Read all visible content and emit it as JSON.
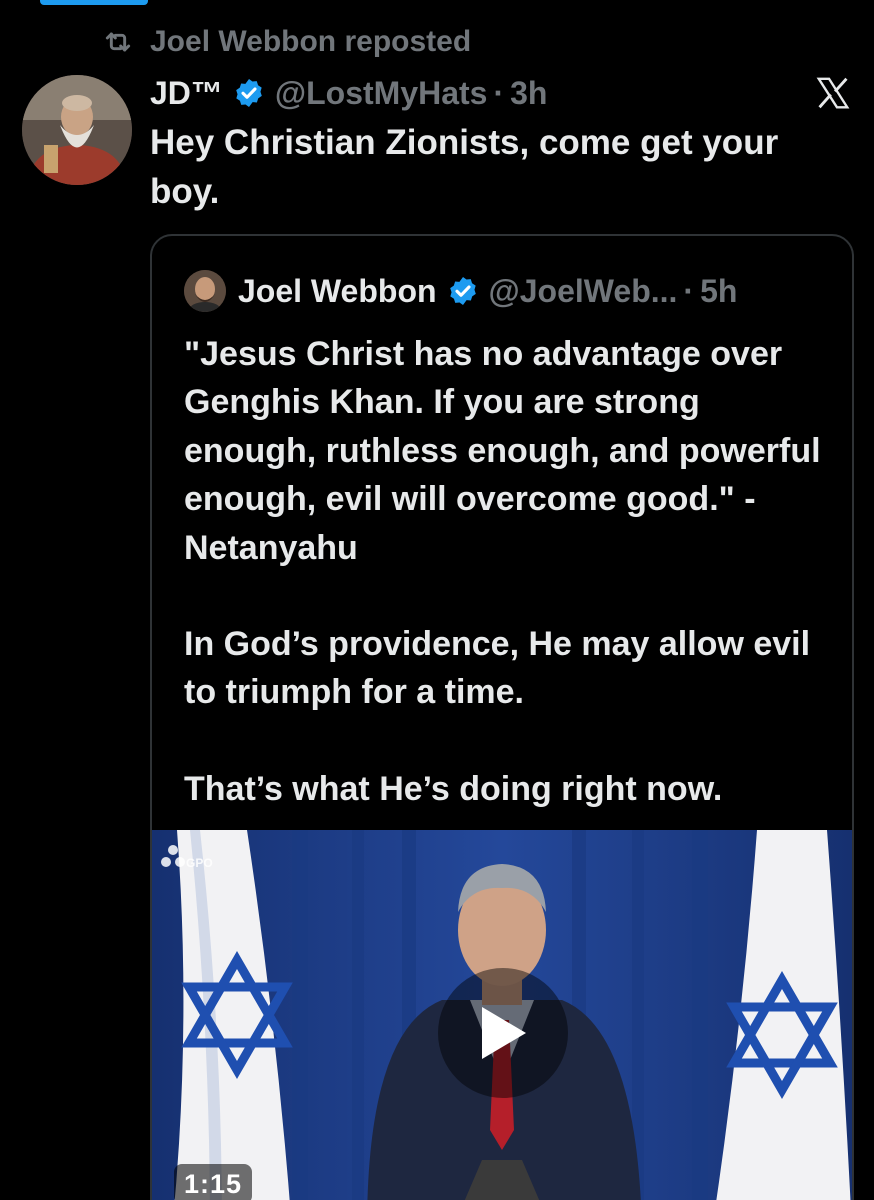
{
  "repost": {
    "icon": "repost-icon",
    "text": "Joel Webbon reposted"
  },
  "post": {
    "display_name": "JD™",
    "verified": true,
    "handle": "@LostMyHats",
    "separator": "·",
    "time": "3h",
    "text": "Hey Christian Zionists, come get your boy."
  },
  "quote": {
    "display_name": "Joel Webbon",
    "verified": true,
    "handle": "@JoelWeb...",
    "separator": "·",
    "time": "5h",
    "paragraphs": [
      "\"Jesus Christ has no advantage over Genghis Khan. If you are strong enough, ruthless enough, and powerful enough, evil will overcome good.\" -Netanyahu",
      "In God’s providence, He may allow evil to triumph for a time.",
      "That’s what He’s doing right now."
    ],
    "video": {
      "watermark": "GPO",
      "duration": "1:15"
    }
  },
  "colors": {
    "background": "#000000",
    "text": "#e7e9ea",
    "muted": "#71767b",
    "accent": "#1d9bf0",
    "border": "#2f3336"
  }
}
